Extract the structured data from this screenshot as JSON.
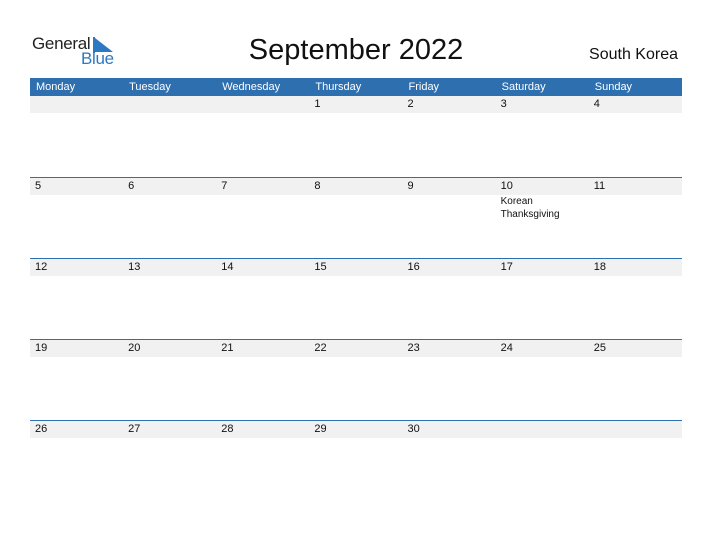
{
  "logo": {
    "word1": "General",
    "word2": "Blue"
  },
  "title": "September 2022",
  "country": "South Korea",
  "colors": {
    "header": "#2e6fb0",
    "strip": "#f1f1f1",
    "brand": "#2b79c2"
  },
  "days": [
    "Monday",
    "Tuesday",
    "Wednesday",
    "Thursday",
    "Friday",
    "Saturday",
    "Sunday"
  ],
  "weeks": [
    {
      "dates": [
        "",
        "",
        "",
        "1",
        "2",
        "3",
        "4"
      ],
      "events": [
        "",
        "",
        "",
        "",
        "",
        "",
        ""
      ]
    },
    {
      "dates": [
        "5",
        "6",
        "7",
        "8",
        "9",
        "10",
        "11"
      ],
      "events": [
        "",
        "",
        "",
        "",
        "",
        "Korean Thanksgiving",
        ""
      ]
    },
    {
      "dates": [
        "12",
        "13",
        "14",
        "15",
        "16",
        "17",
        "18"
      ],
      "events": [
        "",
        "",
        "",
        "",
        "",
        "",
        ""
      ]
    },
    {
      "dates": [
        "19",
        "20",
        "21",
        "22",
        "23",
        "24",
        "25"
      ],
      "events": [
        "",
        "",
        "",
        "",
        "",
        "",
        ""
      ]
    },
    {
      "dates": [
        "26",
        "27",
        "28",
        "29",
        "30",
        "",
        ""
      ],
      "events": [
        "",
        "",
        "",
        "",
        "",
        "",
        ""
      ]
    }
  ]
}
